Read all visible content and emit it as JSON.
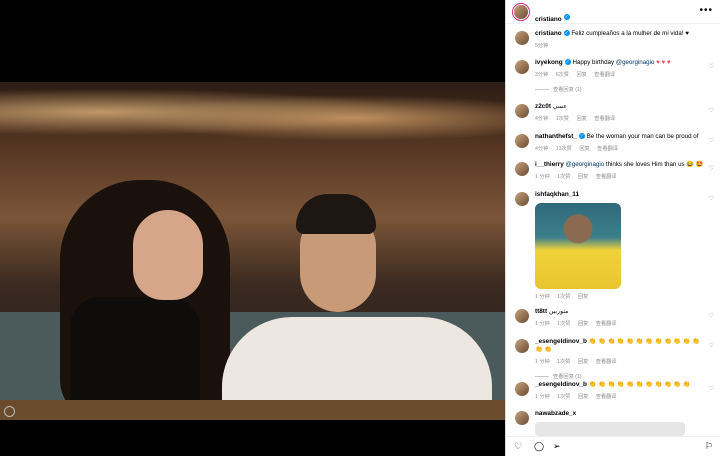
{
  "post": {
    "author": "cristiano",
    "more_label": "•••"
  },
  "caption": {
    "username": "cristiano",
    "text": "Feliz cumpleaños a la mulher de mi vida! ♥",
    "time": "5分钟"
  },
  "comments": [
    {
      "username": "ivyekong",
      "verified": true,
      "mention": "@georginagio",
      "text": " ♥ ♥ ♥",
      "prefix": "Happy birthday ",
      "time": "3分钟",
      "likes": "6次赞",
      "reply": "回复",
      "translate": "查看翻译",
      "replies": "查看回复 (1)"
    },
    {
      "username": "z2c0t",
      "verified": false,
      "text": "عسي",
      "time": "4分钟",
      "likes": "1次赞",
      "reply": "回复",
      "translate": "查看翻译"
    },
    {
      "username": "nathanthefst_",
      "verified": true,
      "text": "Be the woman your man can be proud of",
      "time": "4分钟",
      "likes": "13次赞",
      "reply": "回复",
      "translate": "查看翻译"
    },
    {
      "username": "i__thierry",
      "verified": false,
      "mention": "@georginagio",
      "text": " thinks she loves Him than us 😂 🤩",
      "prefix": "",
      "time": "1 分钟",
      "likes": "1次赞",
      "reply": "回复",
      "translate": "查看翻译"
    },
    {
      "username": "ishfaqkhan_11",
      "verified": false,
      "time": "1 分钟",
      "likes": "1次赞",
      "reply": "回复"
    },
    {
      "username": "tt8tt",
      "verified": false,
      "text": "مثوريبن",
      "time": "1 分钟",
      "likes": "1次赞",
      "reply": "回复",
      "translate": "查看翻译"
    },
    {
      "username": "_esengeldinov_b",
      "verified": false,
      "text": "👏 👏 👏 👏 👏 👏 👏 👏 👏 👏 👏 👏 👏 👏",
      "time": "1 分钟",
      "likes": "1次赞",
      "reply": "回复",
      "translate": "查看翻译",
      "replies": "查看回复 (1)"
    },
    {
      "username": "_esengeldinov_b",
      "verified": false,
      "text": "👏 👏 👏 👏 👏 👏 👏 👏 👏 👏 👏",
      "time": "1 分钟",
      "likes": "1次赞",
      "reply": "回复",
      "translate": "查看翻译"
    },
    {
      "username": "nawabzade_x",
      "verified": false
    }
  ],
  "icons": {
    "like": "heart-icon",
    "comment": "comment-icon",
    "share": "share-icon",
    "save": "bookmark-icon"
  },
  "colors": {
    "link": "#00376b",
    "verified": "#0095f6",
    "heart": "#ed4956"
  }
}
